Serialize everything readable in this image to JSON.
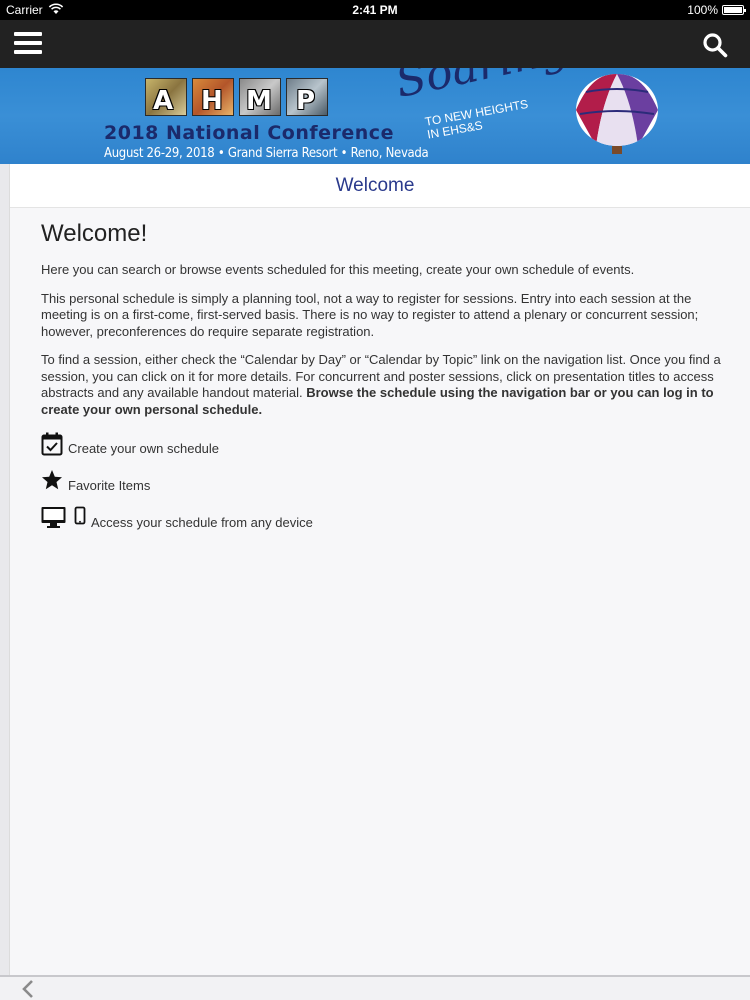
{
  "status_bar": {
    "carrier": "Carrier",
    "time": "2:41 PM",
    "battery": "100%"
  },
  "header": {
    "menu_icon": "hamburger-menu-icon",
    "search_icon": "search-icon",
    "background": "#222222"
  },
  "banner": {
    "logo_letters": [
      "A",
      "H",
      "M",
      "P"
    ],
    "title": "2018 National Conference",
    "dates": "August 26-29, 2018 • Grand Sierra Resort • Reno, Nevada",
    "soaring": "Soaring",
    "tagline_line1": "TO NEW HEIGHTS",
    "tagline_line2": "IN EHS&S",
    "background": "#3a8fd6"
  },
  "page_title": "Welcome",
  "content": {
    "heading": "Welcome!",
    "para1": "Here you can search or browse events scheduled for this meeting, create your own schedule of events.",
    "para2": "This personal schedule is simply a planning tool, not a way to register for sessions. Entry into each session at the meeting is on a first-come, first-served basis. There is no way to register to attend a plenary or concurrent session; however, preconferences do require separate registration.",
    "para3_plain": "To find a session, either check the “Calendar by Day” or “Calendar by Topic” link on the navigation list. Once you find a session, you can click on it for more details. For concurrent and poster sessions, click on presentation titles to access abstracts and any available handout material. ",
    "para3_bold": "Browse the schedule using the navigation bar or you can log in to create your own personal schedule.",
    "features": [
      {
        "icon": "calendar-check-icon",
        "label": "Create your own schedule"
      },
      {
        "icon": "star-icon",
        "label": "Favorite Items"
      },
      {
        "icon": "desktop-mobile-icon",
        "label": "Access your schedule from any device"
      }
    ]
  },
  "bottom_bar": {
    "back_icon": "chevron-left-icon"
  }
}
